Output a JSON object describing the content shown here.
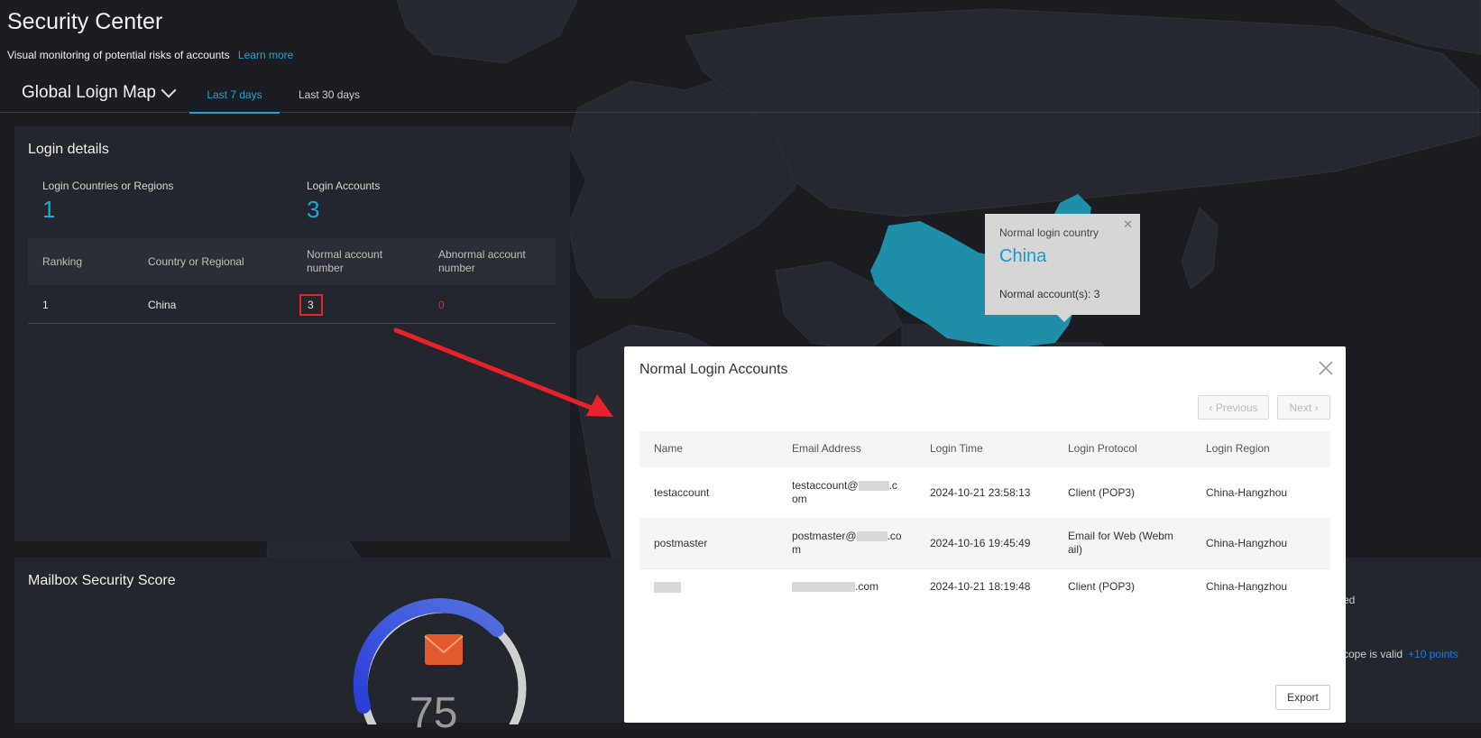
{
  "header": {
    "title": "Security Center",
    "subtitle": "Visual monitoring of potential risks of accounts",
    "learn_more": "Learn more"
  },
  "map": {
    "selector_label": "Global Loign Map",
    "tabs": [
      {
        "label": "Last 7 days",
        "active": true
      },
      {
        "label": "Last 30 days",
        "active": false
      }
    ]
  },
  "login_details": {
    "title": "Login details",
    "countries_label": "Login Countries or Regions",
    "countries_value": "1",
    "accounts_label": "Login Accounts",
    "accounts_value": "3",
    "columns": [
      "Ranking",
      "Country or Regional",
      "Normal account number",
      "Abnormal account number"
    ],
    "rows": [
      {
        "ranking": "1",
        "country": "China",
        "normal": "3",
        "abnormal": "0"
      }
    ]
  },
  "tooltip": {
    "label": "Normal login country",
    "country": "China",
    "count": "Normal account(s): 3"
  },
  "score": {
    "title": "Mailbox Security Score",
    "value": "75",
    "side_text_1": "ed",
    "side_text_2": "cope is valid",
    "side_points": "+10 points"
  },
  "modal": {
    "title": "Normal Login Accounts",
    "prev_label": "‹ Previous",
    "next_label": "Next ›",
    "columns": [
      "Name",
      "Email Address",
      "Login Time",
      "Login Protocol",
      "Login Region"
    ],
    "rows": [
      {
        "name": "testaccount",
        "email_prefix": "testaccount@",
        "email_suffix": ".c",
        "email_line2": "om",
        "time": "2024-10-21 23:58:13",
        "protocol": "Client (POP3)",
        "protocol_line2": "",
        "region": "China-Hangzhou"
      },
      {
        "name": "postmaster",
        "email_prefix": "postmaster@",
        "email_suffix": ".co",
        "email_line2": "m",
        "time": "2024-10-16 19:45:49",
        "protocol": "Email for Web (Webm",
        "protocol_line2": "ail)",
        "region": "China-Hangzhou"
      },
      {
        "name": "",
        "email_prefix": "",
        "email_suffix": ".com",
        "email_line2": "",
        "time": "2024-10-21 18:19:48",
        "protocol": "Client (POP3)",
        "protocol_line2": "",
        "region": "China-Hangzhou"
      }
    ],
    "export_label": "Export"
  },
  "colors": {
    "accent": "#1aa8d8",
    "danger": "#e0262b",
    "china_fill": "#1f8ea8",
    "points": "#1a78e8"
  }
}
